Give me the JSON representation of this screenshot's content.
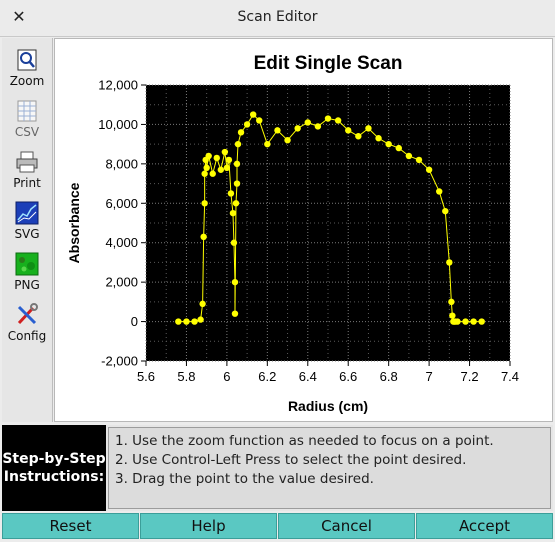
{
  "window": {
    "title": "Scan Editor"
  },
  "toolbar": {
    "items": [
      {
        "label": "Zoom",
        "icon": "zoom-icon"
      },
      {
        "label": "CSV",
        "icon": "csv-icon"
      },
      {
        "label": "Print",
        "icon": "print-icon"
      },
      {
        "label": "SVG",
        "icon": "svg-icon"
      },
      {
        "label": "PNG",
        "icon": "png-icon"
      },
      {
        "label": "Config",
        "icon": "config-icon"
      }
    ]
  },
  "chart_data": {
    "type": "scatter",
    "title": "Edit Single Scan",
    "xlabel": "Radius (cm)",
    "ylabel": "Absorbance",
    "xlim": [
      5.6,
      7.4
    ],
    "ylim": [
      -2000,
      12000
    ],
    "xticks": [
      "5.6",
      "5.8",
      "6",
      "6.2",
      "6.4",
      "6.6",
      "6.8",
      "7",
      "7.2",
      "7.4"
    ],
    "yticks": [
      "-2,000",
      "0",
      "2,000",
      "4,000",
      "6,000",
      "8,000",
      "10,000",
      "12,000"
    ],
    "background": "#000000",
    "marker_color": "#ffff00",
    "grid": true,
    "series": [
      {
        "x": [
          5.76,
          5.8,
          5.84,
          5.87,
          5.88,
          5.885,
          5.89,
          5.89,
          5.895,
          5.9,
          5.91,
          5.93,
          5.95,
          5.97,
          5.99,
          6.0,
          6.01,
          6.02,
          6.03,
          6.035,
          6.04,
          6.04,
          6.045,
          6.05,
          6.05,
          6.055,
          6.07,
          6.1,
          6.13,
          6.16,
          6.2,
          6.25,
          6.3,
          6.35,
          6.4,
          6.45,
          6.5,
          6.55,
          6.6,
          6.65,
          6.7,
          6.75,
          6.8,
          6.85,
          6.9,
          6.95,
          7.0,
          7.05,
          7.08,
          7.1,
          7.11,
          7.115,
          7.12,
          7.125,
          7.13,
          7.14,
          7.18,
          7.22,
          7.26
        ],
        "y": [
          0,
          0,
          0,
          100,
          900,
          4300,
          6000,
          7500,
          8200,
          7800,
          8400,
          7500,
          8300,
          7700,
          8600,
          7800,
          8200,
          6500,
          5500,
          4000,
          2000,
          400,
          6000,
          7000,
          8000,
          9000,
          9600,
          10000,
          10500,
          10200,
          9000,
          9700,
          9200,
          9800,
          10100,
          9900,
          10300,
          10200,
          9700,
          9400,
          9800,
          9300,
          9000,
          8800,
          8400,
          8200,
          7700,
          6600,
          5600,
          3000,
          1000,
          300,
          0,
          0,
          0,
          0,
          0,
          0,
          0
        ]
      }
    ]
  },
  "instructions": {
    "label": "Step-by-Step Instructions:",
    "lines": [
      "1. Use the zoom function as needed to focus on a point.",
      "2. Use Control-Left Press to select the point desired.",
      "3. Drag the point to the value desired."
    ]
  },
  "buttons": {
    "reset": "Reset",
    "help": "Help",
    "cancel": "Cancel",
    "accept": "Accept"
  }
}
